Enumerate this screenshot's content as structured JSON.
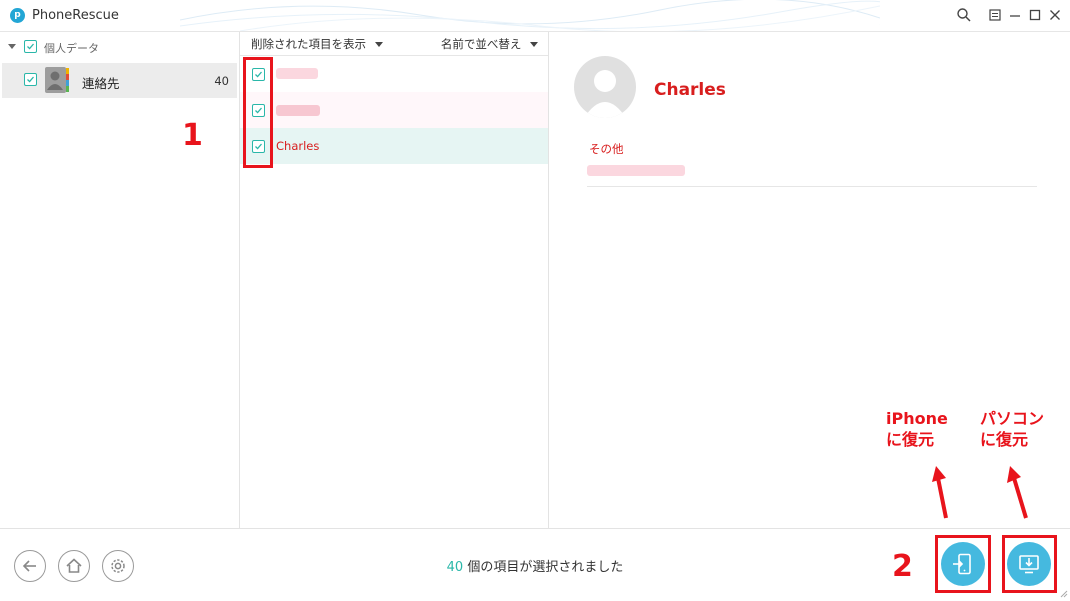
{
  "app": {
    "title": "PhoneRescue",
    "logo_letter": "p"
  },
  "window_controls": [
    "search-icon",
    "menu-icon",
    "minimize-icon",
    "maximize-icon",
    "close-icon"
  ],
  "sidebar": {
    "category": "個人データ",
    "items": [
      {
        "label": "連絡先",
        "count": "40"
      }
    ]
  },
  "list": {
    "filter_label": "削除された項目を表示",
    "sort_label": "名前で並べ替え",
    "rows": [
      {
        "name": "",
        "checked": true,
        "background": "#ffffff"
      },
      {
        "name": "",
        "checked": true,
        "background": "#fff7fa"
      },
      {
        "name": "Charles",
        "checked": true,
        "background": "#e6f5f3"
      }
    ]
  },
  "detail": {
    "name": "Charles",
    "section_label": "その他"
  },
  "footer": {
    "selected_count": "40",
    "selected_text": " 個の項目が選択されました"
  },
  "annotations": {
    "step1": "1",
    "step2": "2",
    "to_iphone_line1": "iPhone",
    "to_iphone_line2": "に復元",
    "to_pc_line1": "パソコン",
    "to_pc_line2": "に復元"
  },
  "colors": {
    "accent": "#2ab7a9",
    "action_blue": "#45b9df",
    "annotation_red": "#e8141c",
    "name_red": "#d81e1e",
    "selected_row": "#e6f5f3"
  }
}
